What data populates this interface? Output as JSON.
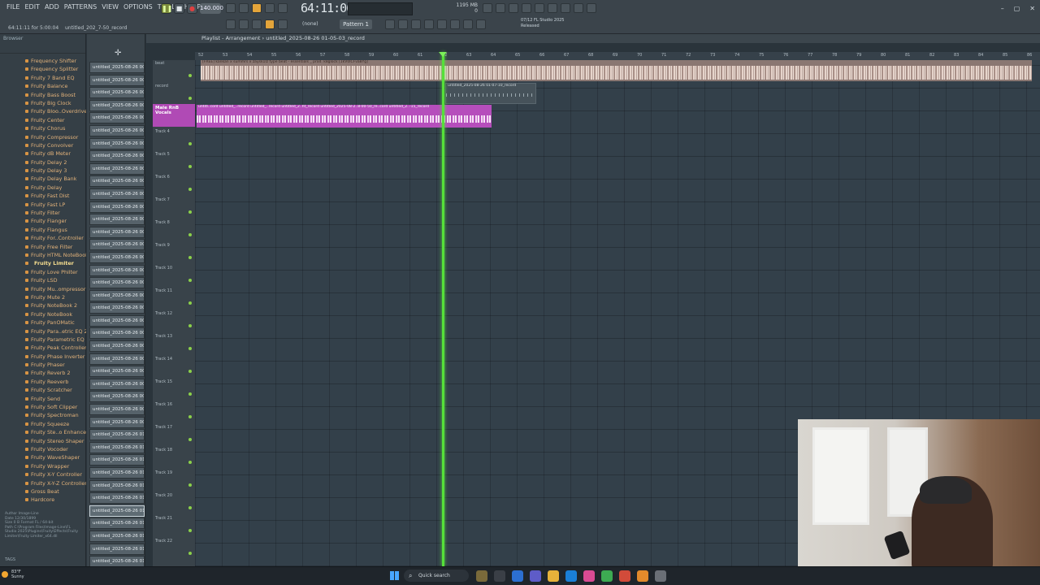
{
  "menu": [
    "FILE",
    "EDIT",
    "ADD",
    "PATTERNS",
    "VIEW",
    "OPTIONS",
    "TOOLS",
    "HELP"
  ],
  "hint": "64:11:11 for 5:00:04",
  "hint2": "untitled_202_7-50_record",
  "transport": {
    "tempo": "140.000",
    "time": "64:11:06",
    "time_small": "'06",
    "memory": "1195 MB",
    "memory_sub": "0"
  },
  "pattern": "Pattern 1",
  "snap": "(none)",
  "flinfo": [
    "07/12 FL Studio 2025",
    "Released"
  ],
  "playlist_title": "Playlist - Arrangement › untitled_2025-08-26 01-05-03_record",
  "browser_title": "Browser",
  "plugins": [
    "Frequency Shifter",
    "Frequency Splitter",
    "Fruity 7 Band EQ",
    "Fruity Balance",
    "Fruity Bass Boost",
    "Fruity Big Clock",
    "Fruity Bloo..Overdrive",
    "Fruity Center",
    "Fruity Chorus",
    "Fruity Compressor",
    "Fruity Convolver",
    "Fruity dB Meter",
    "Fruity Delay 2",
    "Fruity Delay 3",
    "Fruity Delay Bank",
    "Fruity Delay",
    "Fruity Fast Dist",
    "Fruity Fast LP",
    "Fruity Filter",
    "Fruity Flanger",
    "Fruity Flangus",
    "Fruity For..Controller",
    "Fruity Free Filter",
    "Fruity HTML NoteBook",
    "Fruity Limiter",
    "Fruity Love Philter",
    "Fruity LSD",
    "Fruity Mu..ompressor",
    "Fruity Mute 2",
    "Fruity NoteBook 2",
    "Fruity NoteBook",
    "Fruity PanOMatic",
    "Fruity Para..etric EQ 2",
    "Fruity Parametric EQ",
    "Fruity Peak Controller",
    "Fruity Phase Inverter",
    "Fruity Phaser",
    "Fruity Reverb 2",
    "Fruity Reeverb",
    "Fruity Scratcher",
    "Fruity Send",
    "Fruity Soft Clipper",
    "Fruity Spectroman",
    "Fruity Squeeze",
    "Fruity Ste..o Enhancer",
    "Fruity Stereo Shaper",
    "Fruity Vocoder",
    "Fruity WaveShaper",
    "Fruity Wrapper",
    "Fruity X-Y Controller",
    "Fruity X-Y-Z Controller",
    "Gross Beat",
    "Hardcore"
  ],
  "selected_plugin": 24,
  "browser_info": [
    "Author  Image-Line",
    "Date  12/30/1899",
    "Size  0 B        Format  FL / 64-bit",
    "Path  C:\\Program Files\\Image-Line\\FL Studio 2025\\Plugins\\Fruity\\Effects\\Fruity Limiter\\Fruity Limiter_x64.dll"
  ],
  "tags_label": "TAGS",
  "records": [
    "untitled_2025-08-26 00-",
    "untitled_2025-08-26 00-",
    "untitled_2025-08-26 00-",
    "untitled_2025-08-26 00-",
    "untitled_2025-08-26 00-",
    "untitled_2025-08-26 00-",
    "untitled_2025-08-26 00-",
    "untitled_2025-08-26 00-",
    "untitled_2025-08-26 00-",
    "untitled_2025-08-26 00-",
    "untitled_2025-08-26 00-",
    "untitled_2025-08-26 00-",
    "untitled_2025-08-26 00-",
    "untitled_2025-08-26 00-",
    "untitled_2025-08-26 00-",
    "untitled_2025-08-26 00-",
    "untitled_2025-08-26 00-",
    "untitled_2025-08-26 00-",
    "untitled_2025-08-26 00-",
    "untitled_2025-08-26 00-",
    "untitled_2025-08-26 00-",
    "untitled_2025-08-26 00-",
    "untitled_2025-08-26 00-",
    "untitled_2025-08-26 00-",
    "untitled_2025-08-26 00-",
    "untitled_2025-08-26 00-",
    "untitled_2025-08-26 00-",
    "untitled_2025-08-26 00-",
    "untitled_2025-08-26 00-",
    "untitled_2025-08-26 01-",
    "untitled_2025-08-26 01-",
    "untitled_2025-08-26 01-",
    "untitled_2025-08-26 01-",
    "untitled_2025-08-26 01-",
    "untitled_2025-08-26 01-",
    "untitled_2025-08-26 01-",
    "untitled_2025-08-26 01-",
    "untitled_2025-08-26 01-",
    "untitled_2025-08-26 01-",
    "untitled_2025-08-26 01-"
  ],
  "selected_record": 35,
  "track_names": [
    "beat",
    "record",
    "Male RnB Vocals",
    "Track 4",
    "Track 5",
    "Track 6",
    "Track 7",
    "Track 8",
    "Track 9",
    "Track 10",
    "Track 11",
    "Track 12",
    "Track 13",
    "Track 14",
    "Track 15",
    "Track 16",
    "Track 17",
    "Track 18",
    "Track 19",
    "Track 20",
    "Track 21",
    "Track 22"
  ],
  "clips": {
    "beat": "[FREE] kankan x summrs x zaysk1lz type beat - essentials _ prod. k8glock [1kV0lCFva8Yg]",
    "record": "untitled_2025-08-26 01-07-10_record",
    "vocal": "untitl..cord  untitled_..record  untitled_..record  untitled_2..ht_record  untitled_2025-08-2..8-00-50_re..cord  untitled_2..-15_record"
  },
  "ruler_ticks": [
    "52",
    "53",
    "54",
    "55",
    "56",
    "57",
    "58",
    "59",
    "60",
    "61",
    "62",
    "63",
    "64",
    "65",
    "66",
    "67",
    "68",
    "69",
    "70",
    "71",
    "72",
    "73",
    "74",
    "75",
    "76",
    "77",
    "78",
    "79",
    "80",
    "81",
    "82",
    "83",
    "84",
    "85",
    "86"
  ],
  "taskbar": {
    "weather_temp": "83°F",
    "weather_desc": "Sunny",
    "search_placeholder": "Quick search"
  },
  "colors": {
    "playhead": "#56e03a",
    "vocal_clip": "#b64ebc",
    "beat_clip": "#8a7772",
    "plugin_text": "#e2b27a"
  }
}
